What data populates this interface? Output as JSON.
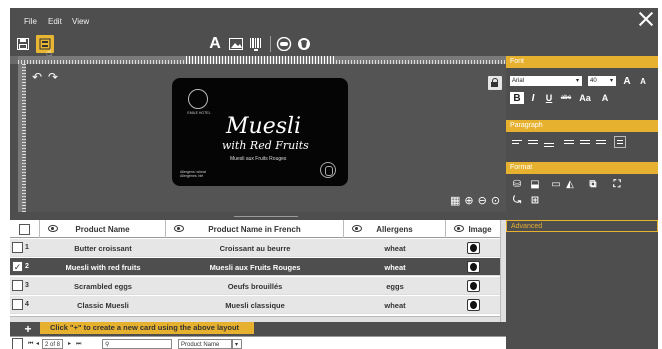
{
  "menu": {
    "file": "File",
    "edit": "Edit",
    "view": "View"
  },
  "toolbar": {
    "text_tool": "A"
  },
  "card": {
    "title": "Muesli",
    "subtitle": "with Red Fruits",
    "french": "Muesli aux Fruits Rouges",
    "logo_text": "EMILE HOTEL",
    "allergens_line": "Allergens: wheat",
    "allergenes_line": "Allergènes: blé"
  },
  "table": {
    "headers": {
      "product_name": "Product Name",
      "product_name_fr": "Product Name in French",
      "allergens": "Allergens",
      "image": "Image"
    },
    "rows": [
      {
        "num": "1",
        "name": "Butter croissant",
        "name_fr": "Croissant au beurre",
        "allergens": "wheat",
        "checked": false
      },
      {
        "num": "2",
        "name": "Muesli with red fruits",
        "name_fr": "Muesli aux Fruits Rouges",
        "allergens": "wheat",
        "checked": true
      },
      {
        "num": "3",
        "name": "Scrambled eggs",
        "name_fr": "Oeufs brouillés",
        "allergens": "eggs",
        "checked": false
      },
      {
        "num": "4",
        "name": "Classic Muesli",
        "name_fr": "Muesli classique",
        "allergens": "wheat",
        "checked": false
      }
    ],
    "check_mark": "✓"
  },
  "hint": {
    "text": "Click \"+\" to create a new card using the above layout"
  },
  "pager": {
    "page": "2 of 8",
    "search_placeholder": "",
    "field": "Product Name"
  },
  "panel": {
    "font_label": "Font",
    "font_family": "Arial",
    "font_size": "40",
    "grow_font": "A",
    "shrink_font": "A",
    "bold": "B",
    "italic": "I",
    "underline": "U",
    "strike": "abc",
    "case": "Aa",
    "color": "A",
    "paragraph_label": "Paragraph",
    "format_label": "Format",
    "advanced_label": "Advanced"
  },
  "colors": {
    "accent": "#e6b12e",
    "chrome": "#4e4e4e",
    "selected_row": "#4e4e4e"
  }
}
